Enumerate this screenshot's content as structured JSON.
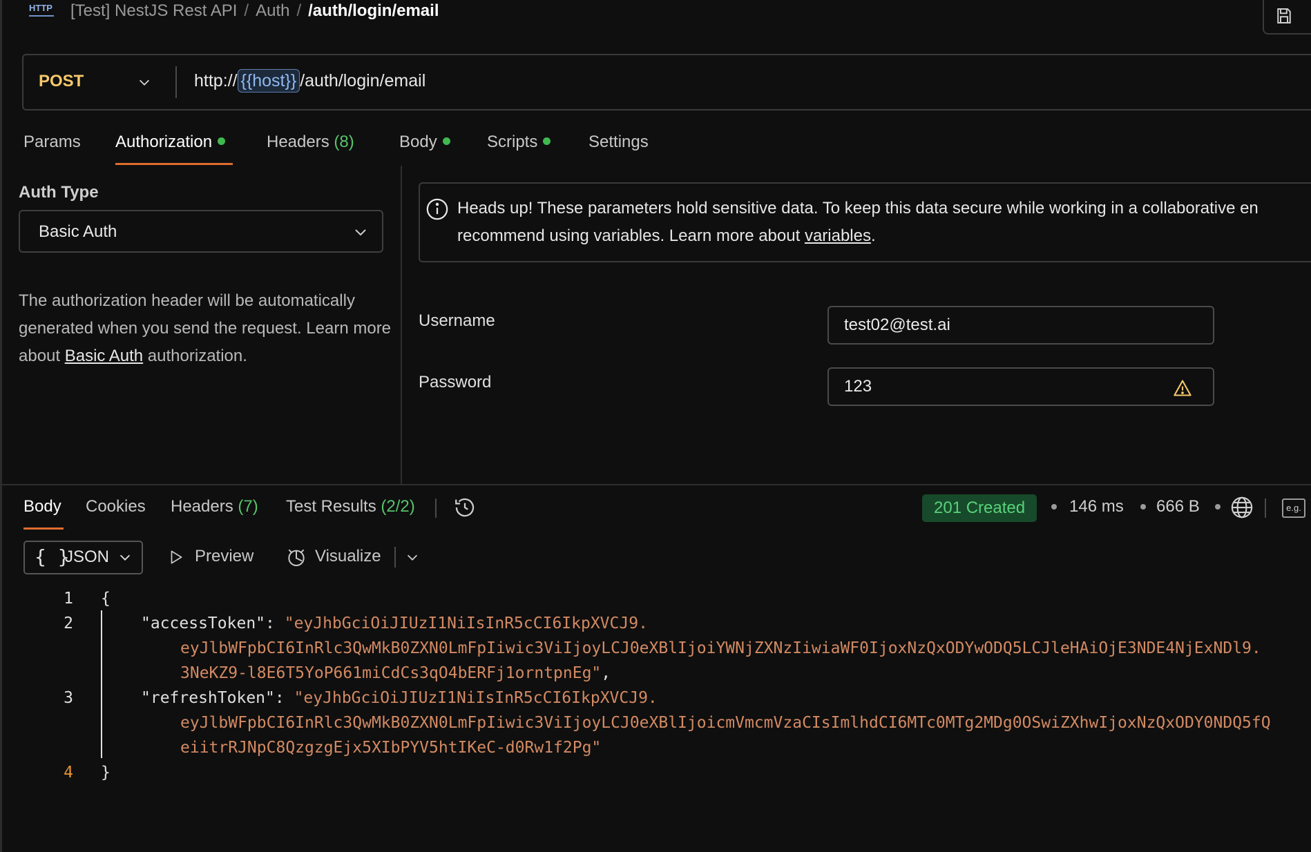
{
  "breadcrumb": {
    "icon_text": "HTTP",
    "collection": "[Test] NestJS Rest API",
    "folder": "Auth",
    "sep": "/",
    "current": "/auth/login/email"
  },
  "request": {
    "method": "POST",
    "url_prefix": "http://",
    "url_var": "{{host}}",
    "url_path": "/auth/login/email"
  },
  "request_tabs": [
    {
      "label": "Params"
    },
    {
      "label": "Authorization",
      "dot": true
    },
    {
      "label": "Headers",
      "count": "(8)"
    },
    {
      "label": "Body",
      "dot": true
    },
    {
      "label": "Scripts",
      "dot": true
    },
    {
      "label": "Settings"
    }
  ],
  "auth": {
    "type_label": "Auth Type",
    "type_value": "Basic Auth",
    "desc_before": "The authorization header will be automatically generated when you send the request. Learn more about ",
    "desc_link": "Basic Auth",
    "desc_after": " authorization."
  },
  "notice": {
    "line1": "Heads up! These parameters hold sensitive data. To keep this data secure while working in a collaborative en",
    "line2_before": "recommend using variables. Learn more about ",
    "line2_link": "variables",
    "line2_after": "."
  },
  "fields": {
    "username_label": "Username",
    "username_value": "test02@test.ai",
    "password_label": "Password",
    "password_value": "123"
  },
  "response_tabs": [
    {
      "label": "Body"
    },
    {
      "label": "Cookies"
    },
    {
      "label": "Headers",
      "count": "(7)"
    },
    {
      "label": "Test Results",
      "count": "(2/2)"
    }
  ],
  "response_meta": {
    "status": "201 Created",
    "time": "146 ms",
    "size": "666 B",
    "eg": "e.g."
  },
  "format_bar": {
    "braces": "{ }",
    "format": "JSON",
    "preview": "Preview",
    "visualize": "Visualize"
  },
  "code": {
    "line_numbers": [
      "1",
      "2",
      "3",
      "4"
    ],
    "open_brace": "{",
    "close_brace": "}",
    "access_key": "\"accessToken\"",
    "colon": ": ",
    "access_l1": "\"eyJhbGciOiJIUzI1NiIsInR5cCI6IkpXVCJ9.",
    "access_l2": "eyJlbWFpbCI6InRlc3QwMkB0ZXN0LmFpIiwic3ViIjoyLCJ0eXBlIjoiYWNjZXNzIiwiaWF0IjoxNzQxODYwODQ5LCJleHAiOjE3NDE4NjExNDl9.",
    "access_l3": "3NeKZ9-l8E6T5YoP661miCdCs3qO4bERFj1orntpnEg\"",
    "comma": ",",
    "refresh_key": "\"refreshToken\"",
    "refresh_l1": "\"eyJhbGciOiJIUzI1NiIsInR5cCI6IkpXVCJ9.",
    "refresh_l2": "eyJlbWFpbCI6InRlc3QwMkB0ZXN0LmFpIiwic3ViIjoyLCJ0eXBlIjoicmVmcmVzaCIsImlhdCI6MTc0MTg2MDg0OSwiZXhwIjoxNzQxODY0NDQ5fQ",
    "refresh_l3": "eiitrRJNpC8QzgzgEjx5XIbPYV5htIKeC-d0Rw1f2Pg\""
  },
  "colors": {
    "accent": "#e06d2f",
    "method": "#f6c86b",
    "status_bg": "#174a2a",
    "status_fg": "#58d27a",
    "string": "#d38a63",
    "count": "#57c46b"
  }
}
